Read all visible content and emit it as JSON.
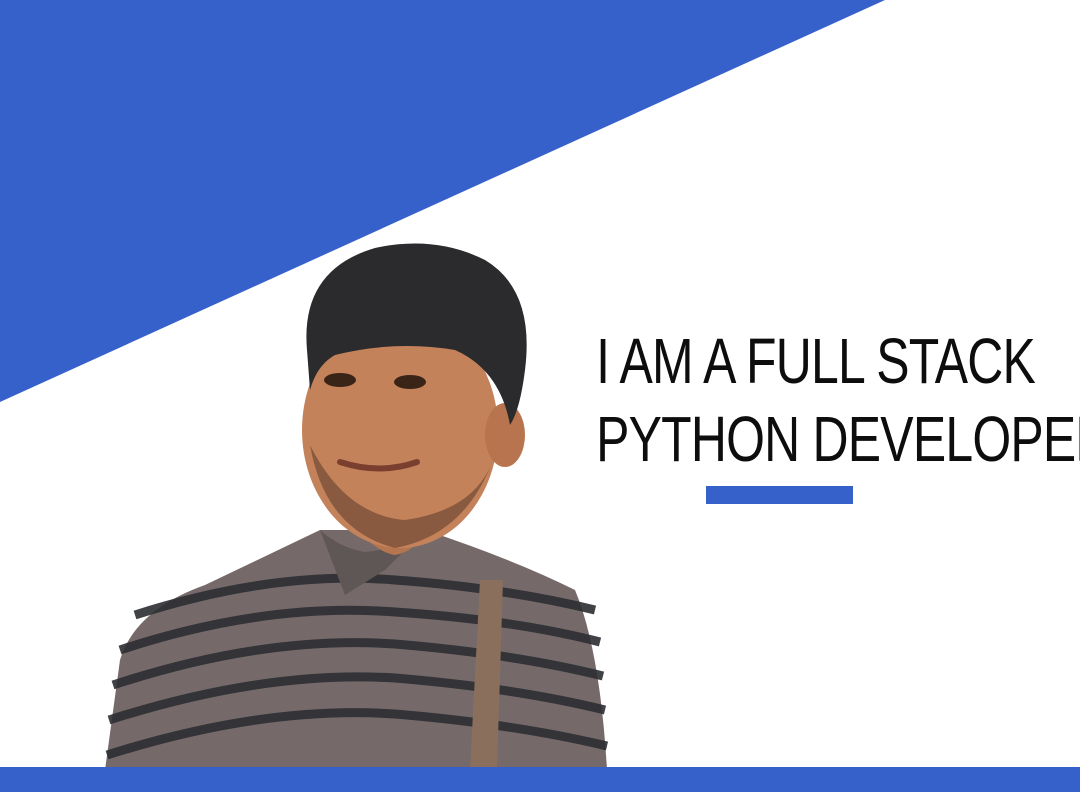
{
  "headline": {
    "line1": "I AM A FULL STACK",
    "line2": "PYTHON DEVELOPER"
  },
  "colors": {
    "accent": "#3661cb",
    "background": "#ffffff",
    "text": "#0d0d0d"
  },
  "photo": {
    "subject": "man-portrait"
  }
}
